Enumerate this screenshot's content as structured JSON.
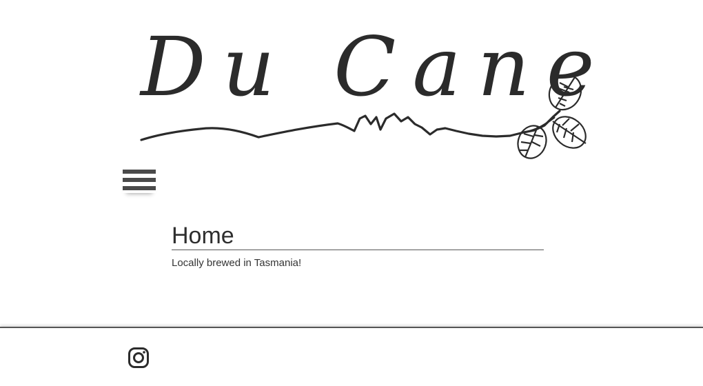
{
  "header": {
    "logo_text": "Du Cane",
    "logo_icon": "mountain-range-and-leaves-logo"
  },
  "nav": {
    "menu_icon": "hamburger-menu-icon"
  },
  "main": {
    "title": "Home",
    "tagline": "Locally brewed in Tasmania!"
  },
  "footer": {
    "social_icon": "instagram-icon"
  },
  "colors": {
    "text": "#333333",
    "logo_ink": "#2b2b2b",
    "menu": "#4a4a4a",
    "divider": "#555555",
    "background": "#ffffff"
  }
}
